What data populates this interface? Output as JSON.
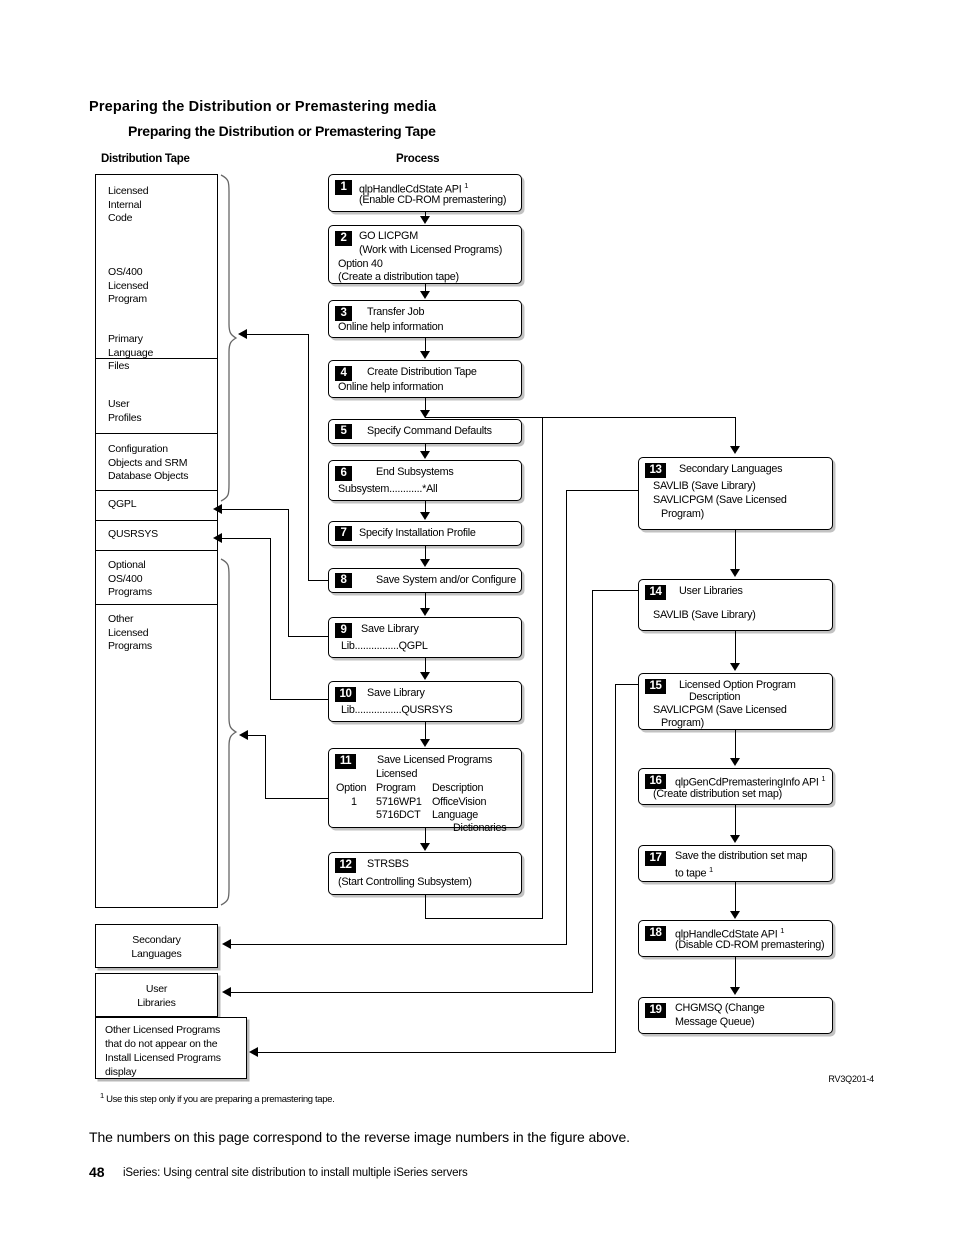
{
  "headings": {
    "main_title": "Preparing the Distribution or Premastering media",
    "sub_title": "Preparing the Distribution or Premastering Tape",
    "column_left": "Distribution Tape",
    "column_center": "Process"
  },
  "distribution_tape": {
    "segments": [
      {
        "lines": [
          "Licensed",
          "Internal",
          "Code"
        ]
      },
      {
        "lines": [
          "OS/400",
          "Licensed",
          "Program"
        ]
      },
      {
        "lines": [
          "Primary",
          "Language",
          "Files"
        ]
      },
      {
        "lines": [
          "User",
          "Profiles"
        ]
      },
      {
        "lines": [
          "Configuration",
          "Objects and SRM",
          "Database Objects"
        ]
      },
      {
        "lines": [
          "QGPL"
        ]
      },
      {
        "lines": [
          "QUSRSYS"
        ]
      },
      {
        "lines": [
          "Optional",
          "OS/400",
          "Programs"
        ]
      },
      {
        "lines": [
          "Other",
          "Licensed",
          "Programs"
        ]
      }
    ]
  },
  "tape_extra_boxes": [
    {
      "lines": [
        "Secondary",
        "Languages"
      ]
    },
    {
      "lines": [
        "User",
        "Libraries"
      ]
    },
    {
      "lines": [
        "Other Licensed Programs",
        "that do not appear on the",
        "Install Licensed Programs",
        "display"
      ]
    }
  ],
  "process_steps": [
    {
      "num": "1",
      "lines": [
        "qlpHandleCdState API ¹",
        "(Enable CD-ROM premastering)"
      ]
    },
    {
      "num": "2",
      "lines": [
        "GO LICPGM",
        "(Work with Licensed Programs)",
        "Option 40",
        "(Create a distribution tape)"
      ]
    },
    {
      "num": "3",
      "lines": [
        "Transfer Job",
        "Online help information"
      ]
    },
    {
      "num": "4",
      "lines": [
        "Create Distribution Tape",
        "Online help information"
      ]
    },
    {
      "num": "5",
      "lines": [
        "Specify Command Defaults"
      ]
    },
    {
      "num": "6",
      "lines": [
        "End Subsystems",
        "Subsystem............*All"
      ]
    },
    {
      "num": "7",
      "lines": [
        "Specify Installation Profile"
      ]
    },
    {
      "num": "8",
      "lines": [
        "Save System and/or Configure"
      ]
    },
    {
      "num": "9",
      "lines": [
        "Save Library",
        "Lib................QGPL"
      ]
    },
    {
      "num": "10",
      "lines": [
        "Save Library",
        "Lib.................QUSRSYS"
      ]
    },
    {
      "num": "11",
      "title": "Save Licensed Programs",
      "table": {
        "headers": [
          "Option",
          "Licensed\nProgram",
          "Description"
        ],
        "rows": [
          [
            "1",
            "5716WP1",
            "OfficeVision"
          ],
          [
            "",
            "5716DCT",
            "Language"
          ],
          [
            "",
            "",
            "Dictionaries"
          ]
        ]
      }
    },
    {
      "num": "12",
      "lines": [
        "STRSBS",
        "(Start Controlling Subsystem)"
      ]
    },
    {
      "num": "13",
      "lines": [
        "Secondary Languages",
        "SAVLIB (Save Library)",
        "SAVLICPGM (Save Licensed",
        "Program)"
      ]
    },
    {
      "num": "14",
      "lines": [
        "User Libraries",
        "SAVLIB (Save Library)"
      ]
    },
    {
      "num": "15",
      "lines": [
        "Licensed Option Program",
        "Description",
        "SAVLICPGM (Save Licensed",
        "Program)"
      ]
    },
    {
      "num": "16",
      "lines": [
        "qlpGenCdPremasteringInfo API ¹",
        "(Create distribution set map)"
      ]
    },
    {
      "num": "17",
      "lines": [
        "Save the distribution set map",
        "to tape ¹"
      ]
    },
    {
      "num": "18",
      "lines": [
        "qlpHandleCdState API ¹",
        "(Disable CD-ROM premastering)"
      ]
    },
    {
      "num": "19",
      "lines": [
        "CHGMSQ (Change",
        "Message Queue)"
      ]
    }
  ],
  "step11_cells": {
    "h_option": "Option",
    "h_licensed": "Licensed",
    "h_program": "Program",
    "h_description": "Description",
    "r1_option": "1",
    "r1_program": "5716WP1",
    "r1_desc": "OfficeVision",
    "r2_program": "5716DCT",
    "r2_desc": "Language",
    "r3_desc": "Dictionaries"
  },
  "footer": {
    "figure_id": "RV3Q201-4",
    "footnote_mark": "1",
    "footnote_text": "Use this step only if you are preparing a premastering tape.",
    "caption": "The numbers on this page correspond to the reverse image numbers in the figure above.",
    "page_number": "48",
    "page_title": "iSeries:  Using central site distribution to install multiple iSeries servers"
  }
}
